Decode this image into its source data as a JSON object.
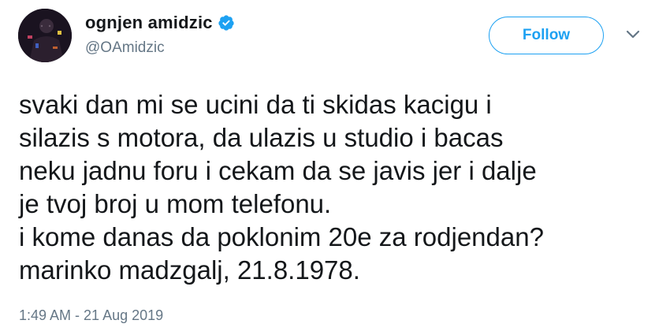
{
  "user": {
    "display_name": "ognjen amidzic",
    "handle": "@OAmidzic",
    "verified": true,
    "avatar_icon": "profile-photo"
  },
  "actions": {
    "follow_label": "Follow",
    "menu_icon": "chevron-down-icon"
  },
  "tweet": {
    "lines": [
      "svaki dan mi se ucini da ti skidas kacigu i",
      "silazis s motora, da ulazis u studio i bacas",
      "neku jadnu foru i cekam da se javis jer i dalje",
      "je tvoj broj u mom telefonu.",
      "i kome danas da poklonim 20e za rodjendan?",
      "marinko madzgalj, 21.8.1978."
    ],
    "timestamp": "1:49 AM - 21 Aug 2019"
  },
  "colors": {
    "accent": "#1da1f2",
    "text": "#14171a",
    "secondary": "#657786"
  }
}
